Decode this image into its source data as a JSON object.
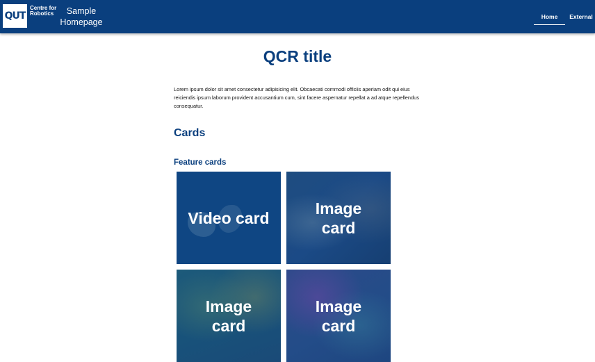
{
  "header": {
    "logo_mark": "QUT",
    "logo_sub_line1": "Centre for",
    "logo_sub_line2": "Robotics",
    "site_title": "Sample Homepage",
    "nav": [
      {
        "label": "Home",
        "active": true
      },
      {
        "label": "External",
        "active": false
      }
    ]
  },
  "main": {
    "title": "QCR title",
    "intro": "Lorem ipsum dolor sit amet consectetur adipisicing elit. Obcaecati commodi officiis aperiam odit qui eius reiciendis ipsum laborum provident accusantium cum, sint facere aspernatur repellat a ad atque repellendus consequatur.",
    "section_heading": "Cards",
    "sub_heading": "Feature cards",
    "cards": [
      {
        "label": "Video card"
      },
      {
        "label": "Image card"
      },
      {
        "label": "Image card"
      },
      {
        "label": "Image card"
      }
    ]
  },
  "colors": {
    "brand": "#0a3f7e",
    "text": "#111111",
    "background": "#ffffff"
  }
}
